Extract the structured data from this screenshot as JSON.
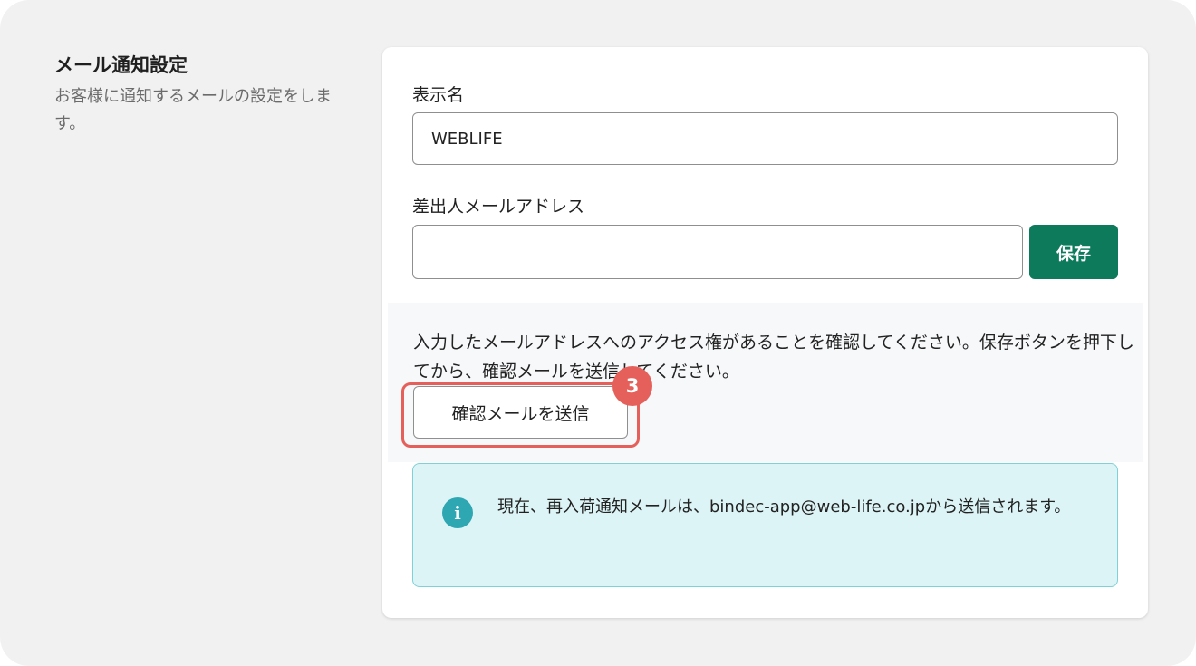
{
  "section": {
    "title": "メール通知設定",
    "description": "お客様に通知するメールの設定をします。"
  },
  "form": {
    "display_name_label": "表示名",
    "display_name_value": "WEBLIFE",
    "sender_email_label": "差出人メールアドレス",
    "sender_email_value": "",
    "save_label": "保存"
  },
  "verify": {
    "text": "入力したメールアドレスへのアクセス権があることを確認してください。保存ボタンを押下してから、確認メールを送信してください。",
    "button_label": "確認メールを送信"
  },
  "annotation": {
    "step_number": "3"
  },
  "info": {
    "icon": "info-icon",
    "icon_glyph": "i",
    "text": "現在、再入荷通知メールは、bindec-app@web-life.co.jpから送信されます。"
  },
  "colors": {
    "save_button": "#0e7a5c",
    "highlight": "#e5605a",
    "info_background": "#ddf4f6",
    "info_icon": "#2ea7b3"
  }
}
